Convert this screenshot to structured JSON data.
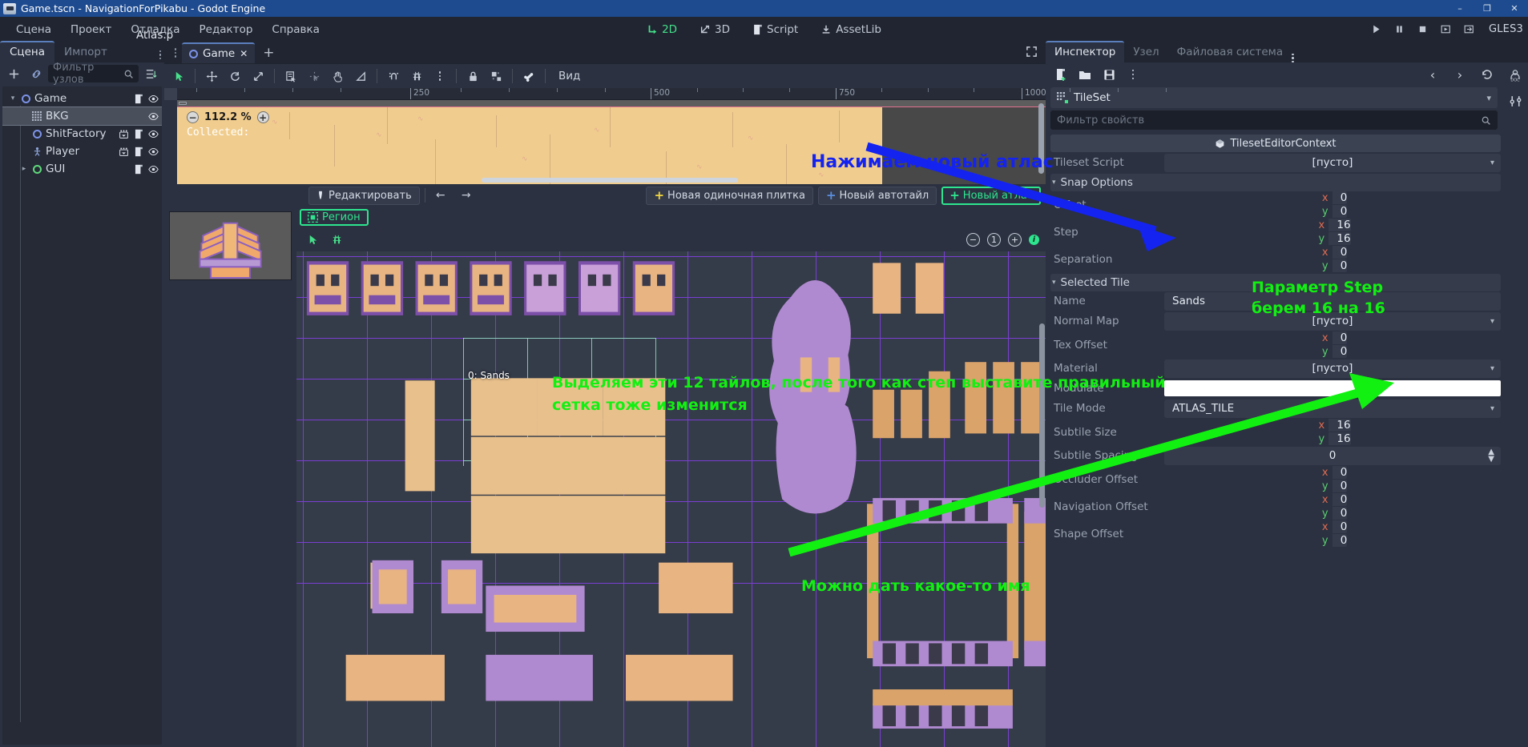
{
  "window": {
    "title": "Game.tscn - NavigationForPikabu - Godot Engine",
    "minimize": "–",
    "maximize": "❐",
    "close": "✕"
  },
  "menu": {
    "items": [
      "Сцена",
      "Проект",
      "Отладка",
      "Редактор",
      "Справка"
    ]
  },
  "main_tabs": [
    {
      "label": "2D",
      "active": true
    },
    {
      "label": "3D",
      "active": false
    },
    {
      "label": "Script",
      "active": false
    },
    {
      "label": "AssetLib",
      "active": false
    }
  ],
  "renderer": "GLES3",
  "scene_panel": {
    "tabs": [
      {
        "label": "Сцена",
        "active": true
      },
      {
        "label": "Импорт",
        "active": false
      }
    ],
    "filter_placeholder": "Фильтр узлов",
    "tree": [
      {
        "label": "Game",
        "icon": "node2d-icon",
        "depth": 0,
        "selected": false,
        "expanded": true,
        "script": true,
        "vis": true
      },
      {
        "label": "BKG",
        "icon": "tilemap-icon",
        "depth": 1,
        "selected": true,
        "script": false,
        "vis": true
      },
      {
        "label": "ShitFactory",
        "icon": "node2d-icon",
        "depth": 1,
        "selected": false,
        "script": true,
        "anim": true,
        "vis": true
      },
      {
        "label": "Player",
        "icon": "kinematic-icon",
        "depth": 1,
        "selected": false,
        "script": true,
        "anim": true,
        "vis": true
      },
      {
        "label": "GUI",
        "icon": "control-icon",
        "depth": 1,
        "selected": false,
        "expanded": false,
        "script": true,
        "vis": true
      }
    ]
  },
  "viewport": {
    "tab_label": "Game",
    "tab_close": "✕",
    "add_tab": "+",
    "view_menu": "Вид",
    "zoom_percent": "112.2 %",
    "zoom_minus": "−",
    "zoom_plus": "+",
    "overlay_text": "Collected:",
    "ruler_labels": [
      "250",
      "500",
      "750",
      "1000"
    ]
  },
  "tileset_editor": {
    "edit_button": "Редактировать",
    "nav_prev": "←",
    "nav_next": "→",
    "new_single_tile": "Новая одиночная плитка",
    "new_autotile": "Новый автотайл",
    "new_atlas": "Новый атлас",
    "atlas_name": "Atlas.p",
    "region_button": "Регион",
    "zoom_out": "−",
    "zoom_reset": "1",
    "zoom_in": "+",
    "info": "i",
    "selected_tile_label": "0: Sands"
  },
  "inspector": {
    "tabs": [
      {
        "label": "Инспектор",
        "active": true
      },
      {
        "label": "Узел",
        "active": false
      },
      {
        "label": "Файловая система",
        "active": false
      }
    ],
    "nav_prev": "‹",
    "nav_next": "›",
    "object_name": "TileSet",
    "filter_placeholder": "Фильтр свойств",
    "context_header": "TilesetEditorContext",
    "empty_value": "[пусто]",
    "properties": [
      {
        "kind": "drop",
        "label": "Tileset Script",
        "value": "[пусто]"
      },
      {
        "kind": "section",
        "label": "Snap Options"
      },
      {
        "kind": "vec2",
        "label": "Offset",
        "x": "0",
        "y": "0"
      },
      {
        "kind": "vec2",
        "label": "Step",
        "x": "16",
        "y": "16"
      },
      {
        "kind": "vec2",
        "label": "Separation",
        "x": "0",
        "y": "0"
      },
      {
        "kind": "section",
        "label": "Selected Tile"
      },
      {
        "kind": "plain",
        "label": "Name",
        "value": "Sands"
      },
      {
        "kind": "drop",
        "label": "Normal Map",
        "value": "[пусто]"
      },
      {
        "kind": "vec2",
        "label": "Tex Offset",
        "x": "0",
        "y": "0"
      },
      {
        "kind": "drop",
        "label": "Material",
        "value": "[пусто]"
      },
      {
        "kind": "color",
        "label": "Modulate",
        "value": "#ffffff"
      },
      {
        "kind": "drop",
        "label": "Tile Mode",
        "value": "ATLAS_TILE"
      },
      {
        "kind": "vec2",
        "label": "Subtile Size",
        "x": "16",
        "y": "16"
      },
      {
        "kind": "spin",
        "label": "Subtile Spacing",
        "value": "0"
      },
      {
        "kind": "vec2",
        "label": "Occluder Offset",
        "x": "0",
        "y": "0"
      },
      {
        "kind": "vec2",
        "label": "Navigation Offset",
        "x": "0",
        "y": "0"
      },
      {
        "kind": "vec2",
        "label": "Shape Offset",
        "x": "0",
        "y": "0"
      }
    ]
  },
  "annotations": [
    {
      "id": "a1",
      "text": "Нажимаем новый атлас",
      "color": "#1423f0"
    },
    {
      "id": "a2",
      "text": "Параметр Step",
      "color": "#12f012"
    },
    {
      "id": "a3",
      "text": "берем 16 на 16",
      "color": "#12f012"
    },
    {
      "id": "a4",
      "text": "Выделяем эти 12 тайлов, после того как степ выставите правильный",
      "color": "#12f012"
    },
    {
      "id": "a5",
      "text": "сетка тоже изменится",
      "color": "#12f012"
    },
    {
      "id": "a6",
      "text": "Можно дать какое-то имя",
      "color": "#12f012"
    }
  ]
}
